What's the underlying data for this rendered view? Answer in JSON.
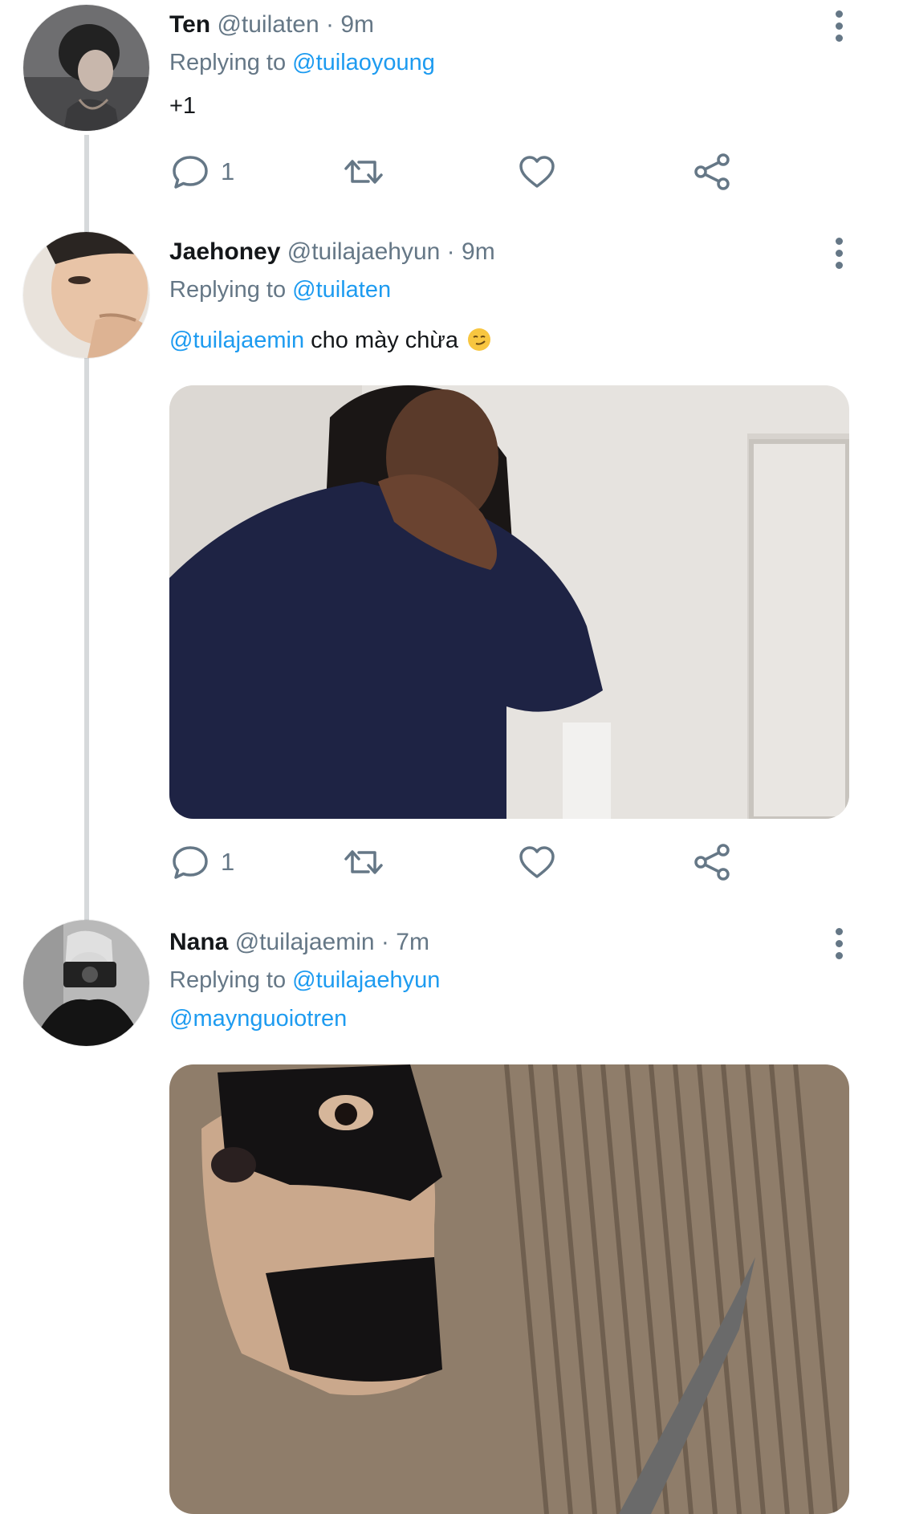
{
  "tweets": [
    {
      "name": "Ten",
      "handle": "@tuilaten",
      "time": "9m",
      "replying_label": "Replying to",
      "replying_to": "@tuilaoyoung",
      "text": "+1",
      "reply_count": "1"
    },
    {
      "name": "Jaehoney",
      "handle": "@tuilajaehyun",
      "time": "9m",
      "replying_label": "Replying to",
      "replying_to": "@tuilaten",
      "mention": "@tuilajaemin",
      "text": "cho mày chừa",
      "emoji": "smirking-face-emoji",
      "reply_count": "1"
    },
    {
      "name": "Nana",
      "handle": "@tuilajaemin",
      "time": "7m",
      "replying_label": "Replying to",
      "replying_to": "@tuilajaehyun",
      "mention": "@maynguoiotren"
    }
  ],
  "colors": {
    "link": "#1d9bf0",
    "secondary": "#657786",
    "thread_line": "#d6d9db"
  }
}
